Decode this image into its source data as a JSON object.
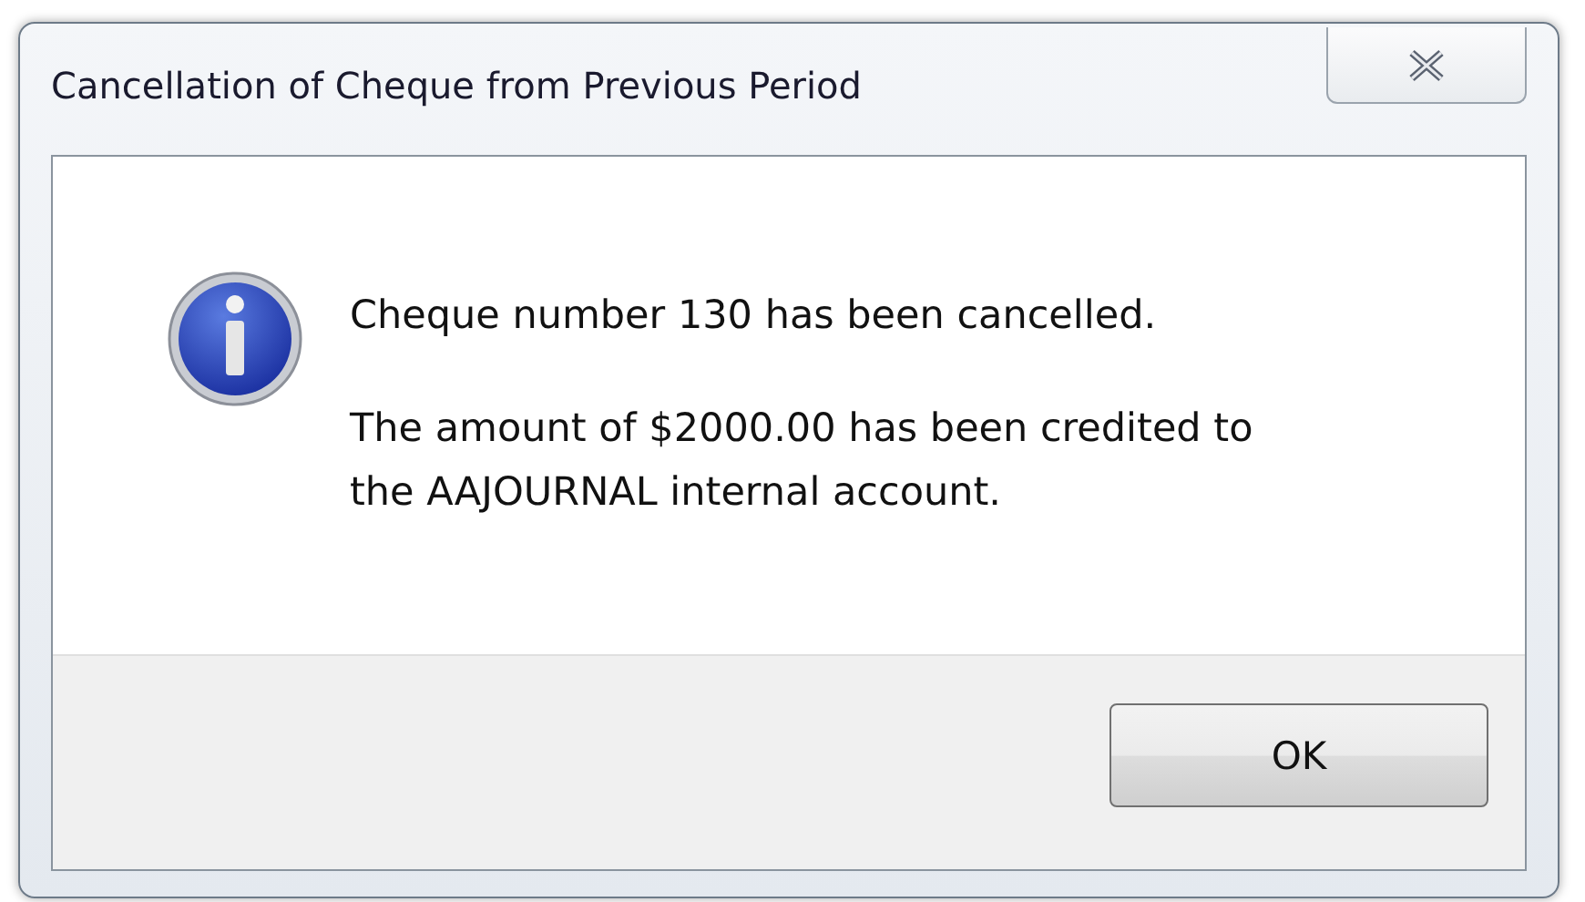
{
  "window": {
    "title": "Cancellation of Cheque from Previous Period"
  },
  "message": {
    "paragraphs": [
      "Cheque number 130 has been cancelled.",
      "The amount of $2000.00 has been credited to the AAJOURNAL internal account."
    ]
  },
  "buttons": [
    "OK"
  ]
}
